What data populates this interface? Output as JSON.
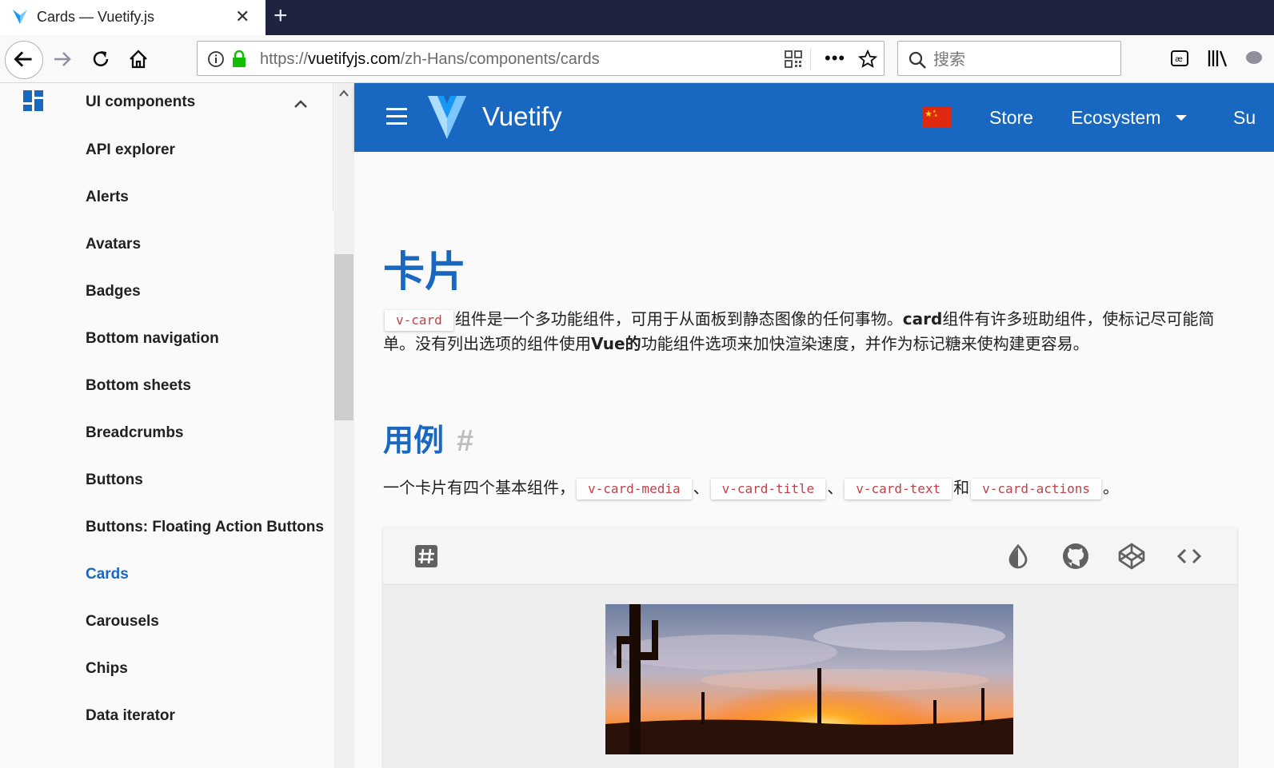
{
  "browser": {
    "tab_title": "Cards — Vuetify.js",
    "url_scheme": "https://",
    "url_host": "vuetifyjs.com",
    "url_path": "/zh-Hans/components/cards",
    "search_placeholder": "搜索"
  },
  "sidebar": {
    "group_label": "UI components",
    "items": [
      {
        "label": "API explorer"
      },
      {
        "label": "Alerts"
      },
      {
        "label": "Avatars"
      },
      {
        "label": "Badges"
      },
      {
        "label": "Bottom navigation"
      },
      {
        "label": "Bottom sheets"
      },
      {
        "label": "Breadcrumbs"
      },
      {
        "label": "Buttons"
      },
      {
        "label": "Buttons: Floating Action Buttons"
      },
      {
        "label": "Cards",
        "active": true
      },
      {
        "label": "Carousels"
      },
      {
        "label": "Chips"
      },
      {
        "label": "Data iterator"
      }
    ]
  },
  "appbar": {
    "brand": "Vuetify",
    "store": "Store",
    "ecosystem": "Ecosystem",
    "support_partial": "Su"
  },
  "main": {
    "title": "卡片",
    "intro": {
      "code": "v-card",
      "text1": "组件是一个多功能组件，可用于从面板到静态图像的任何事物。",
      "bold1": "card",
      "text2": "组件有许多班助组件，使标记尽可能简单。没有列出选项的组件使用",
      "bold2": "Vue的",
      "text3": "功能组件选项来加快渲染速度，并作为标记糖来使构建更容易。"
    },
    "section_title": "用例",
    "section_anchor": "#",
    "usage": {
      "prefix": "一个卡片有四个基本组件，",
      "codes": [
        "v-card-media",
        "v-card-title",
        "v-card-text",
        "v-card-actions"
      ],
      "sep1": "、",
      "sep2": "、",
      "and": "和",
      "end": "。"
    }
  },
  "colors": {
    "primary": "#1867c0",
    "code_text": "#bd4147",
    "flag_red": "#de2910"
  }
}
